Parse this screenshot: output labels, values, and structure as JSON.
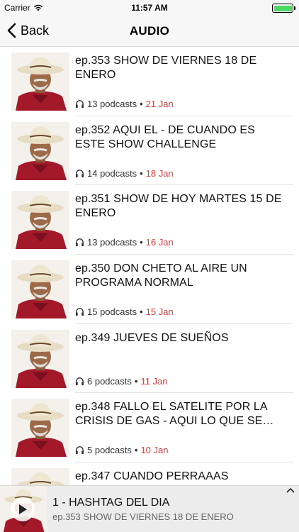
{
  "status_bar": {
    "carrier": "Carrier",
    "time": "11:57 AM"
  },
  "nav": {
    "back_label": "Back",
    "title": "AUDIO"
  },
  "episodes": [
    {
      "title": "ep.353 SHOW DE VIERNES 18 DE ENERO",
      "podcasts": "13 podcasts",
      "date": "21 Jan"
    },
    {
      "title": "ep.352 AQUI EL - DE CUANDO ES ESTE SHOW CHALLENGE",
      "podcasts": "14 podcasts",
      "date": "18 Jan"
    },
    {
      "title": "ep.351 SHOW DE HOY MARTES 15 DE ENERO",
      "podcasts": "13 podcasts",
      "date": "16 Jan"
    },
    {
      "title": "ep.350 DON CHETO AL AIRE UN PROGRAMA NORMAL",
      "podcasts": "15 podcasts",
      "date": "15 Jan"
    },
    {
      "title": "ep.349 JUEVES DE SUEÑOS",
      "podcasts": "6 podcasts",
      "date": "11 Jan"
    },
    {
      "title": "ep.348 FALLO EL SATELITE POR LA CRISIS DE GAS - AQUI LO QUE SE…",
      "podcasts": "5 podcasts",
      "date": "10 Jan"
    },
    {
      "title": "ep.347 CUANDO PERRAAAS",
      "podcasts": "",
      "date": ""
    }
  ],
  "player": {
    "track_title": "1 - HASHTAG DEL DIA",
    "episode": "ep.353 SHOW DE VIERNES 18 DE ENERO"
  },
  "icons": {
    "back": "chevron-left-icon",
    "headphones": "headphones-icon",
    "play": "play-icon",
    "expand": "chevron-up-icon",
    "wifi": "wifi-icon",
    "battery": "battery-icon"
  },
  "colors": {
    "date_accent": "#e03b3b",
    "battery_fill": "#4cd964",
    "bar_bg": "#f7f7f7"
  }
}
